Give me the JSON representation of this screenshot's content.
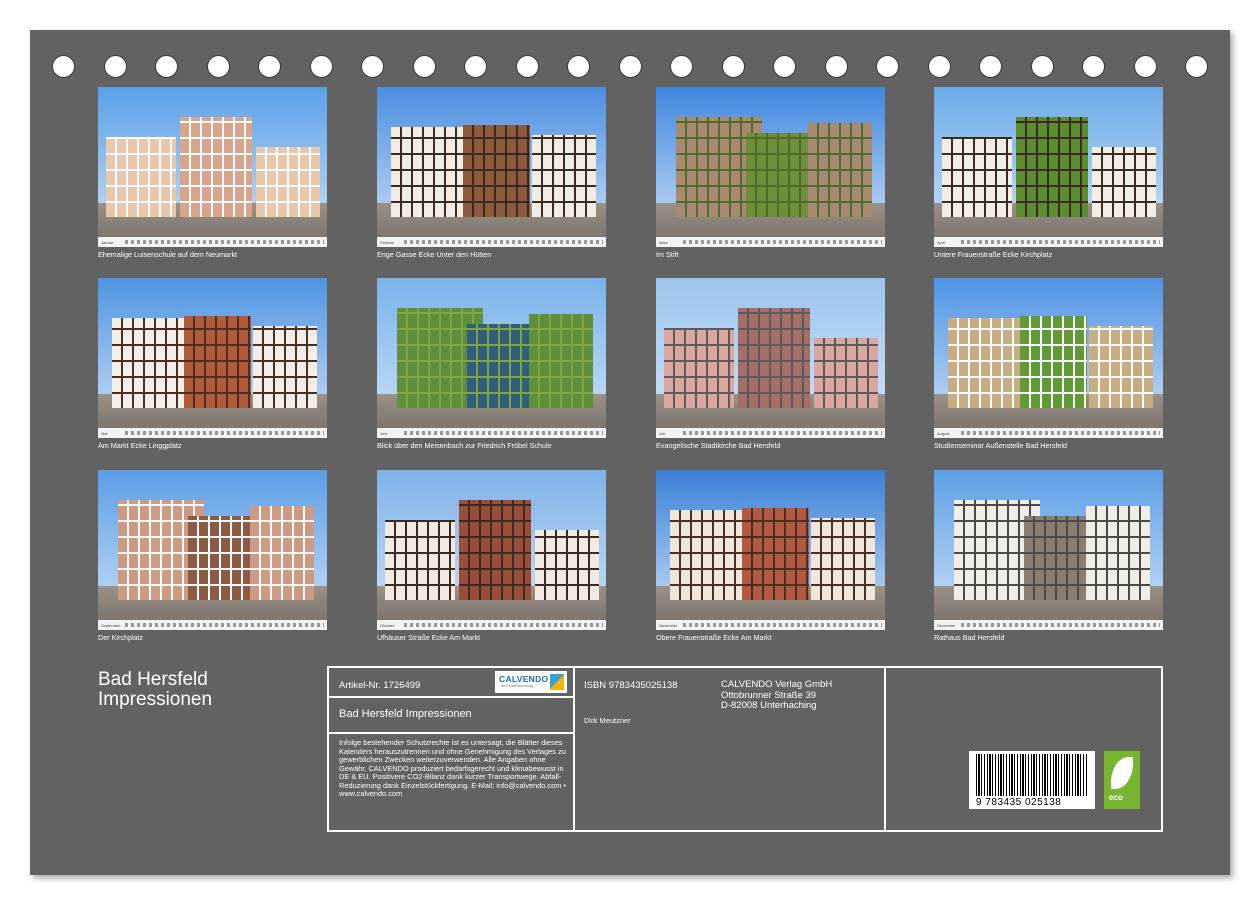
{
  "photos": [
    {
      "caption": "Ehemalige Luisenschule auf dem Neumarkt",
      "month": "Januar",
      "palette": {
        "sky": "#5aa0e8",
        "bld": "#e9c7ab",
        "bld2": "#d9a48c",
        "trim": "#ffffff"
      }
    },
    {
      "caption": "Enge Gasse Ecke Unter den Hütten",
      "month": "Februar",
      "palette": {
        "sky": "#4b8ee0",
        "bld": "#f1ece4",
        "bld2": "#8c5a3c",
        "trim": "#3b2a20"
      }
    },
    {
      "caption": "Im Stift",
      "month": "März",
      "palette": {
        "sky": "#3f86df",
        "bld": "#a98a70",
        "bld2": "#6f8f3a",
        "trim": "#4f6d2a"
      }
    },
    {
      "caption": "Untere Frauenstraße Ecke Kirchplatz",
      "month": "April",
      "palette": {
        "sky": "#6aaae8",
        "bld": "#f2eee6",
        "bld2": "#5a8d2d",
        "trim": "#3b2a20"
      }
    },
    {
      "caption": "Am Markt Ecke Linggplatz",
      "month": "Mai",
      "palette": {
        "sky": "#4e94e2",
        "bld": "#f3efe8",
        "bld2": "#b25a3a",
        "trim": "#4a3022"
      }
    },
    {
      "caption": "Blick über den Meisenbach zur Friedrich Fröbel Schule",
      "month": "Juni",
      "palette": {
        "sky": "#79b2ec",
        "bld": "#5f8f3a",
        "bld2": "#2f5f7a",
        "trim": "#7fa545"
      }
    },
    {
      "caption": "Evangelische Stadtkirche Bad Hersfeld",
      "month": "Juli",
      "palette": {
        "sky": "#9cc5ee",
        "bld": "#d9a6a0",
        "bld2": "#a56f68",
        "trim": "#5a5a5a"
      }
    },
    {
      "caption": "Studienseminar Außenstelle Bad Hersfeld",
      "month": "August",
      "palette": {
        "sky": "#4f93e4",
        "bld": "#c9ad82",
        "bld2": "#5f9a35",
        "trim": "#ffffff"
      }
    },
    {
      "caption": "Der Kirchplatz",
      "month": "September",
      "palette": {
        "sky": "#5a9de6",
        "bld": "#cf9a82",
        "bld2": "#8f5a44",
        "trim": "#ffffff"
      }
    },
    {
      "caption": "Ufhäuser Straße Ecke Am Markt",
      "month": "Oktober",
      "palette": {
        "sky": "#7fb2e8",
        "bld": "#f1ebe4",
        "bld2": "#9a4e3a",
        "trim": "#3b2a20"
      }
    },
    {
      "caption": "Obere Frauenstraße Ecke Am Markt",
      "month": "November",
      "palette": {
        "sky": "#3a7fd8",
        "bld": "#efe7dc",
        "bld2": "#b45a42",
        "trim": "#4a3022"
      }
    },
    {
      "caption": "Rathaus Bad Hersfeld",
      "month": "Dezember",
      "palette": {
        "sky": "#5b9ee6",
        "bld": "#f0ece6",
        "bld2": "#8a7e70",
        "trim": "#4a4a4a"
      }
    }
  ],
  "title": {
    "line1": "Bad Hersfeld",
    "line2": "Impressionen"
  },
  "info": {
    "article": "Artikel-Nr. 1726499",
    "logo_text": "CALVENDO",
    "logo_sub": "dein Kalenderverlag",
    "book_title": "Bad Hersfeld Impressionen",
    "legal": "Infolge bestehender Schutzrechte ist es untersagt, die Blätter dieses Kalenders herauszutrennen und ohne Genehmigung des Verlages zu gewerblichen Zwecken weiterzuverwenden. Alle Angaben ohne Gewähr. CALVENDO produziert bedarfsgerecht und klimabewusst in DE & EU. Positivere CO2-Bilanz dank kurzer Transportwege. Abfall-Reduzierung dank Einzelstückfertigung. E-Mail: info@calvendo.com • www.calvendo.com",
    "isbn": "ISBN 9783435025138",
    "author": "Dirk Meutzner",
    "publisher_name": "CALVENDO Verlag GmbH",
    "publisher_street": "Ottobrunner Straße 39",
    "publisher_city": "D-82008 Unterhaching",
    "barcode_number": "9 783435 025138",
    "eco_label": "eco"
  }
}
